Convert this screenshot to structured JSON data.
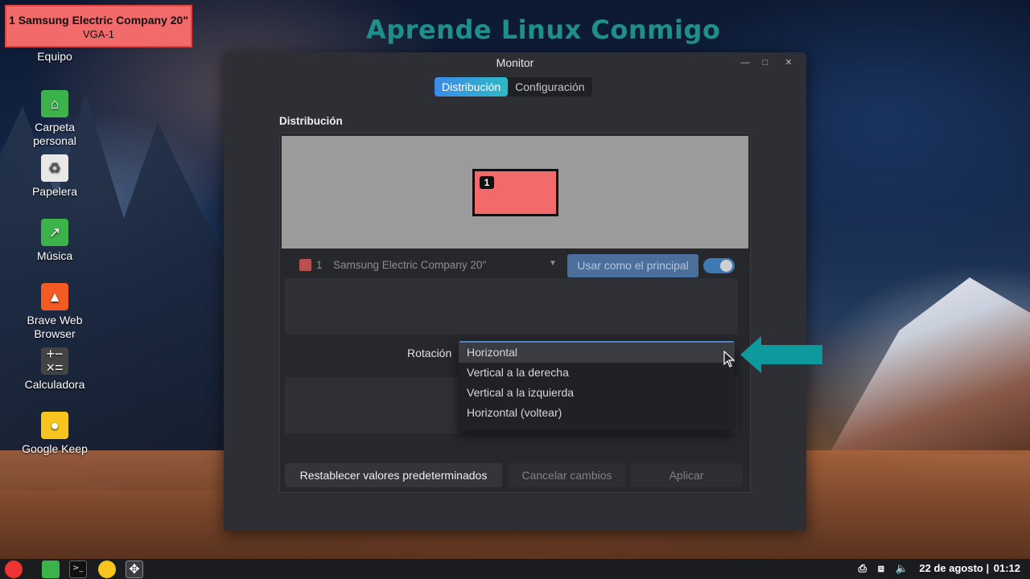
{
  "banner": "Aprende Linux Conmigo",
  "osd": {
    "line1": "1  Samsung Electric Company 20\"",
    "line2": "VGA-1"
  },
  "desktop_icons": [
    {
      "label": "Equipo",
      "icon": "computer-icon"
    },
    {
      "label": "Carpeta personal",
      "icon": "home-folder-icon"
    },
    {
      "label": "Papelera",
      "icon": "trash-icon"
    },
    {
      "label": "Música",
      "icon": "music-folder-icon"
    },
    {
      "label": "Brave Web Browser",
      "icon": "brave-icon"
    },
    {
      "label": "Calculadora",
      "icon": "calculator-icon"
    },
    {
      "label": "Google Keep",
      "icon": "keep-icon"
    }
  ],
  "window": {
    "title": "Monitor",
    "tabs": [
      "Distribución",
      "Configuración"
    ],
    "active_tab": "Distribución",
    "section_title": "Distribución",
    "monitor_badge": "1",
    "display_row": {
      "number": "1",
      "name": "Samsung Electric Company 20\"",
      "primary_label": "Usar como el principal",
      "enabled": true
    },
    "rotation": {
      "label": "Rotación",
      "options": [
        "Horizontal",
        "Vertical a la derecha",
        "Vertical a la izquierda",
        "Horizontal (voltear)"
      ],
      "selected": "Horizontal"
    },
    "buttons": {
      "reset": "Restablecer valores predeterminados",
      "cancel": "Cancelar cambios",
      "apply": "Aplicar"
    }
  },
  "taskbar": {
    "date": "22 de agosto",
    "time": "01:12"
  },
  "colors": {
    "monitor_red": "#f26a6a",
    "banner_teal": "#1f8f8c",
    "arrow_teal": "#0e9a9c",
    "tab_accent": "#3a8be8"
  }
}
